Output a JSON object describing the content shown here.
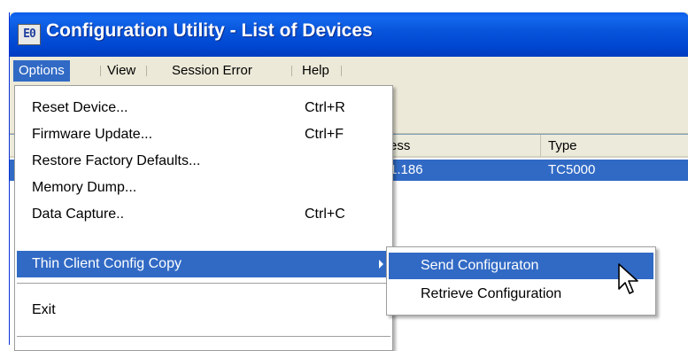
{
  "window": {
    "title": "Configuration Utility - List of Devices",
    "icon_label": "E0"
  },
  "menubar": {
    "items": [
      {
        "label": "Options"
      },
      {
        "label": "View"
      },
      {
        "label": "Session Error"
      },
      {
        "label": "Help"
      }
    ]
  },
  "list": {
    "columns": [
      {
        "label": "ess"
      },
      {
        "label": "Type"
      }
    ],
    "rows": [
      {
        "address": "1.186",
        "type": "TC5000"
      }
    ]
  },
  "options_menu": {
    "items": [
      {
        "label": "Reset Device...",
        "shortcut": "Ctrl+R"
      },
      {
        "label": "Firmware Update...",
        "shortcut": "Ctrl+F"
      },
      {
        "label": "Restore Factory Defaults...",
        "shortcut": ""
      },
      {
        "label": "Memory Dump...",
        "shortcut": ""
      },
      {
        "label": "Data Capture..",
        "shortcut": "Ctrl+C"
      },
      {
        "label": "Thin Client Config Copy",
        "shortcut": ""
      },
      {
        "label": "Exit",
        "shortcut": ""
      }
    ]
  },
  "submenu": {
    "items": [
      {
        "label": "Send Configuraton"
      },
      {
        "label": "Retrieve Configuration"
      }
    ]
  },
  "colors": {
    "titlebar": "#0054e3",
    "selection": "#316ac5",
    "menu_face": "#ece9d8"
  },
  "icons": [
    "app-icon",
    "submenu-arrow-icon",
    "mouse-pointer-icon"
  ]
}
